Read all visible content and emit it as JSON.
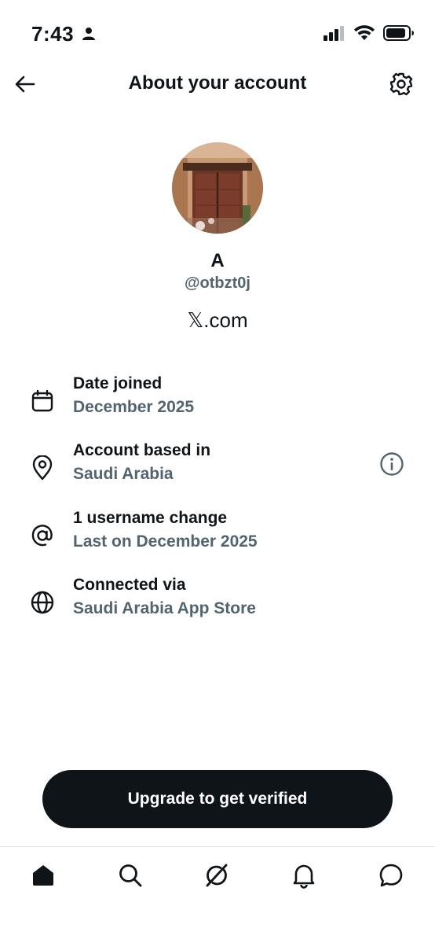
{
  "status_bar": {
    "time": "7:43"
  },
  "header": {
    "title": "About your account"
  },
  "profile": {
    "name": "A",
    "handle": "@otbzt0j",
    "site": "𝕏.com"
  },
  "info_rows": [
    {
      "title": "Date joined",
      "value": "December 2025",
      "icon": "calendar-icon"
    },
    {
      "title": "Account based in",
      "value": "Saudi Arabia",
      "icon": "location-pin-icon"
    },
    {
      "title": "1 username change",
      "value": "Last on December 2025",
      "icon": "at-sign-icon"
    },
    {
      "title": "Connected via",
      "value": "Saudi Arabia App Store",
      "icon": "globe-icon"
    }
  ],
  "cta": {
    "label": "Upgrade to get verified"
  },
  "tabs": [
    {
      "name": "home",
      "icon": "home-icon"
    },
    {
      "name": "search",
      "icon": "search-icon"
    },
    {
      "name": "grok",
      "icon": "grok-icon"
    },
    {
      "name": "notifications",
      "icon": "bell-icon"
    },
    {
      "name": "messages",
      "icon": "chat-bubble-icon"
    }
  ]
}
